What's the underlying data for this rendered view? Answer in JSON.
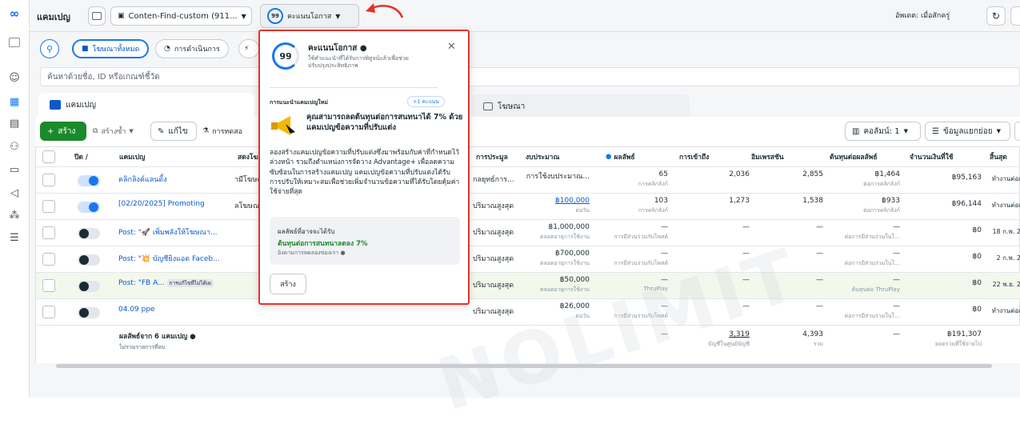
{
  "topbar": {
    "section": "แคมเปญ",
    "account_select": "Conten-Find-custom (911...",
    "score_value": "99",
    "score_label": "คะแนนโอกาส",
    "update_text": "อัพเดต: เมื่อสักครู่"
  },
  "filters": {
    "chip_all_ads": "โฆษณาทั้งหมด",
    "chip_in_progress": "การดำเนินการ",
    "search_placeholder": "ค้นหาด้วยชื่อ, ID หรือเกณฑ์ชี้วัด"
  },
  "tabs": {
    "campaigns": "แคมเปญ",
    "ads": "โฆษณา"
  },
  "toolbar": {
    "create": "สร้าง",
    "duplicate": "สร้างซ้ำ",
    "edit": "แก้ไข",
    "test": "การทดสอ",
    "columns": "คอลัมน์: 1",
    "breakdown": "ข้อมูลแยกย่อย"
  },
  "table": {
    "headers": {
      "onoff": "ปิด /",
      "campaign": "แคมเปญ",
      "delivery": "สดงโฆ",
      "bid": "การประมูล",
      "budget": "งบประมาณ",
      "results": "ผลลัพธ์",
      "reach": "การเข้าถึง",
      "impressions": "อิมเพรสชัน",
      "cost_per_result": "ต้นทุนต่อผลลัพธ์",
      "spent": "จำนวนเงินที่ใช้",
      "ends": "สิ้นสุด"
    },
    "rows": [
      {
        "on": true,
        "name": "คลิกลิงค์แลนดิ้ง",
        "delivery": "ามีโฆษณ",
        "bid": "กลยุทธ์การ...",
        "budget": "การใช้งบประมาณ...",
        "budget_sub": "",
        "results": "65",
        "results_sub": "การคลิกลิงก์",
        "reach": "2,036",
        "impressions": "2,855",
        "cpr": "฿1,464",
        "cpr_sub": "ต่อการคลิกลิงก์",
        "spent": "฿95,163",
        "ends": "ทำงานต่อเ"
      },
      {
        "on": true,
        "name": "[02/20/2025] Promoting",
        "delivery": "ลโฆษณ",
        "bid": "ปริมาณสูงสุด",
        "budget": "฿100,000",
        "budget_sub": "ต่อวัน",
        "results": "103",
        "results_sub": "การคลิกลิงก์",
        "reach": "1,273",
        "impressions": "1,538",
        "cpr": "฿933",
        "cpr_sub": "ต่อการคลิกลิงก์",
        "spent": "฿96,144",
        "ends": "ทำงานต่อเ"
      },
      {
        "on": false,
        "name": "Post: \"🚀 เพิ่มพลังให้โฆษณา...",
        "delivery": "",
        "bid": "ปริมาณสูงสุด",
        "budget": "฿1,000,000",
        "budget_sub": "ตลอดอายุการใช้งาน",
        "results": "—",
        "results_sub": "การมีส่วนร่วมกับโพสต์",
        "reach": "—",
        "impressions": "—",
        "cpr": "—",
        "cpr_sub": "ต่อการมีส่วนร่วมในโ...",
        "spent": "฿0",
        "ends": "18 ก.พ. 2"
      },
      {
        "on": false,
        "name": "Post: \"💥 บัญชียิงแอด Faceb...",
        "delivery": "",
        "bid": "ปริมาณสูงสุด",
        "budget": "฿700,000",
        "budget_sub": "ตลอดอายุการใช้งาน",
        "results": "—",
        "results_sub": "การมีส่วนร่วมกับโพสต์",
        "reach": "—",
        "impressions": "—",
        "cpr": "—",
        "cpr_sub": "ต่อการมีส่วนร่วมในโ...",
        "spent": "฿0",
        "ends": "2 ก.พ. 2"
      },
      {
        "on": false,
        "name": "Post: \"FB A...",
        "tag": "การแก้ไขที่ไม่ได้เผ",
        "delivery": "",
        "bid": "ปริมาณสูงสุด",
        "budget": "฿50,000",
        "budget_sub": "ตลอดอายุการใช้งาน",
        "results": "—",
        "results_sub": "ThruPlay",
        "reach": "—",
        "impressions": "—",
        "cpr": "—",
        "cpr_sub": "ต้นทุนต่อ ThruPlay",
        "spent": "฿0",
        "ends": "22 พ.ย. 2"
      },
      {
        "on": false,
        "name": "04.09 ppe",
        "delivery": "",
        "bid": "ปริมาณสูงสุด",
        "budget": "฿26,000",
        "budget_sub": "ต่อวัน",
        "results": "—",
        "results_sub": "การมีส่วนร่วมกับโพสต์",
        "reach": "—",
        "impressions": "—",
        "cpr": "—",
        "cpr_sub": "ต่อการมีส่วนร่วมในโ...",
        "spent": "฿0",
        "ends": "ทำงานต่อเ"
      }
    ],
    "summary": {
      "label": "ผลลัพธ์จาก 6 แคมเปญ",
      "note": "ไม่รวมรายการที่ลบ",
      "results": "—",
      "reach": "3,319",
      "reach_sub": "บัญชีในศูนย์บัญชี",
      "impressions": "4,393",
      "impressions_sub": "รวม",
      "cpr": "—",
      "spent": "฿191,307",
      "spent_sub": "ยอดรวมที่ใช้จ่ายไป"
    }
  },
  "popover": {
    "score": "99",
    "title": "คะแนนโอกาส",
    "subtitle": "ใช้คำแนะนำที่ได้รับการพิสูจน์แล้วเพื่อช่วยปรับปรุงประสิทธิภาพ",
    "section_label": "การแนะนำแคมเปญใหม่",
    "points_badge": "+1 คะแนน",
    "headline": "คุณสามารถลดต้นทุนต่อการสนทนาได้ 7% ด้วยแคมเปญข้อความที่ปรับแต่ง",
    "body": "ลองสร้างแคมเปญข้อความที่ปรับแต่งซึ่งมาพร้อมกับค่าที่กำหนดไว้ล่วงหน้า รวมถึงตำแหน่งการจัดวาง Advantage+ เพื่อลดความซับซ้อนในการสร้างแคมเปญ แคมเปญข้อความที่ปรับแต่งได้รับการปรับให้เหมาะสมเพื่อช่วยเพิ่มจำนวนข้อความที่ได้รับโดยคุ้มค่าใช้จ่ายที่สุด",
    "result_label": "ผลลัพธ์ที่อาจจะได้รับ",
    "result_value": "ต้นทุนต่อการสนทนาลดลง 7%",
    "result_note": "อิงตามการทดลองของเรา",
    "create_button": "สร้าง"
  },
  "watermark": "NOLIMIT",
  "colors": {
    "accent": "#1877f2",
    "highlight": "#e4322b",
    "green": "#1a8a2c"
  }
}
